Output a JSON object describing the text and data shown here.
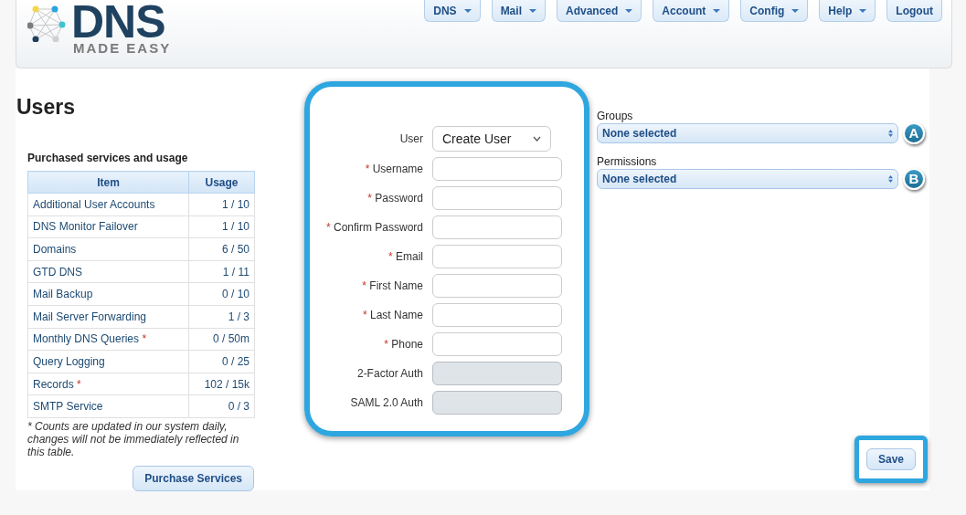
{
  "logo": {
    "wordmark": "DNS",
    "tagline": "MADE EASY"
  },
  "nav": [
    {
      "label": "DNS",
      "dropdown": true
    },
    {
      "label": "Mail",
      "dropdown": true
    },
    {
      "label": "Advanced",
      "dropdown": true
    },
    {
      "label": "Account",
      "dropdown": true
    },
    {
      "label": "Config",
      "dropdown": true
    },
    {
      "label": "Help",
      "dropdown": true
    },
    {
      "label": "Logout",
      "dropdown": false
    }
  ],
  "page_title": "Users",
  "usage": {
    "title": "Purchased services and usage",
    "columns": [
      "Item",
      "Usage"
    ],
    "note_mark": "*",
    "rows": [
      {
        "item": "Additional User Accounts",
        "usage": "1 / 10",
        "noted": false
      },
      {
        "item": "DNS Monitor Failover",
        "usage": "1 / 10",
        "noted": false
      },
      {
        "item": "Domains",
        "usage": "6 / 50",
        "noted": false
      },
      {
        "item": "GTD DNS",
        "usage": "1 / 11",
        "noted": false
      },
      {
        "item": "Mail Backup",
        "usage": "0 / 10",
        "noted": false
      },
      {
        "item": "Mail Server Forwarding",
        "usage": "1 / 3",
        "noted": false
      },
      {
        "item": "Monthly DNS Queries",
        "usage": "0 / 50m",
        "noted": true
      },
      {
        "item": "Query Logging",
        "usage": "0 / 25",
        "noted": false
      },
      {
        "item": "Records",
        "usage": "102 / 15k",
        "noted": true
      },
      {
        "item": "SMTP Service",
        "usage": "0 / 3",
        "noted": false
      }
    ],
    "footnote": "* Counts are updated in our system daily, changes will not be immediately reflected in this table.",
    "button": "Purchase Services"
  },
  "form": {
    "required_mark": "*",
    "fields": [
      {
        "label": "User",
        "kind": "select",
        "value": "Create User",
        "required": false,
        "disabled": false
      },
      {
        "label": "Username",
        "kind": "text",
        "required": true,
        "disabled": false
      },
      {
        "label": "Password",
        "kind": "text",
        "required": true,
        "disabled": false
      },
      {
        "label": "Confirm Password",
        "kind": "text",
        "required": true,
        "disabled": false
      },
      {
        "label": "Email",
        "kind": "text",
        "required": true,
        "disabled": false
      },
      {
        "label": "First Name",
        "kind": "text",
        "required": true,
        "disabled": false
      },
      {
        "label": "Last Name",
        "kind": "text",
        "required": true,
        "disabled": false
      },
      {
        "label": "Phone",
        "kind": "text",
        "required": true,
        "disabled": false
      },
      {
        "label": "2-Factor Auth",
        "kind": "text",
        "required": false,
        "disabled": true
      },
      {
        "label": "SAML 2.0 Auth",
        "kind": "text",
        "required": false,
        "disabled": true
      }
    ]
  },
  "multiselects": [
    {
      "label": "Groups",
      "value": "None selected",
      "callout": "A"
    },
    {
      "label": "Permissions",
      "value": "None selected",
      "callout": "B"
    }
  ],
  "save_button": "Save"
}
